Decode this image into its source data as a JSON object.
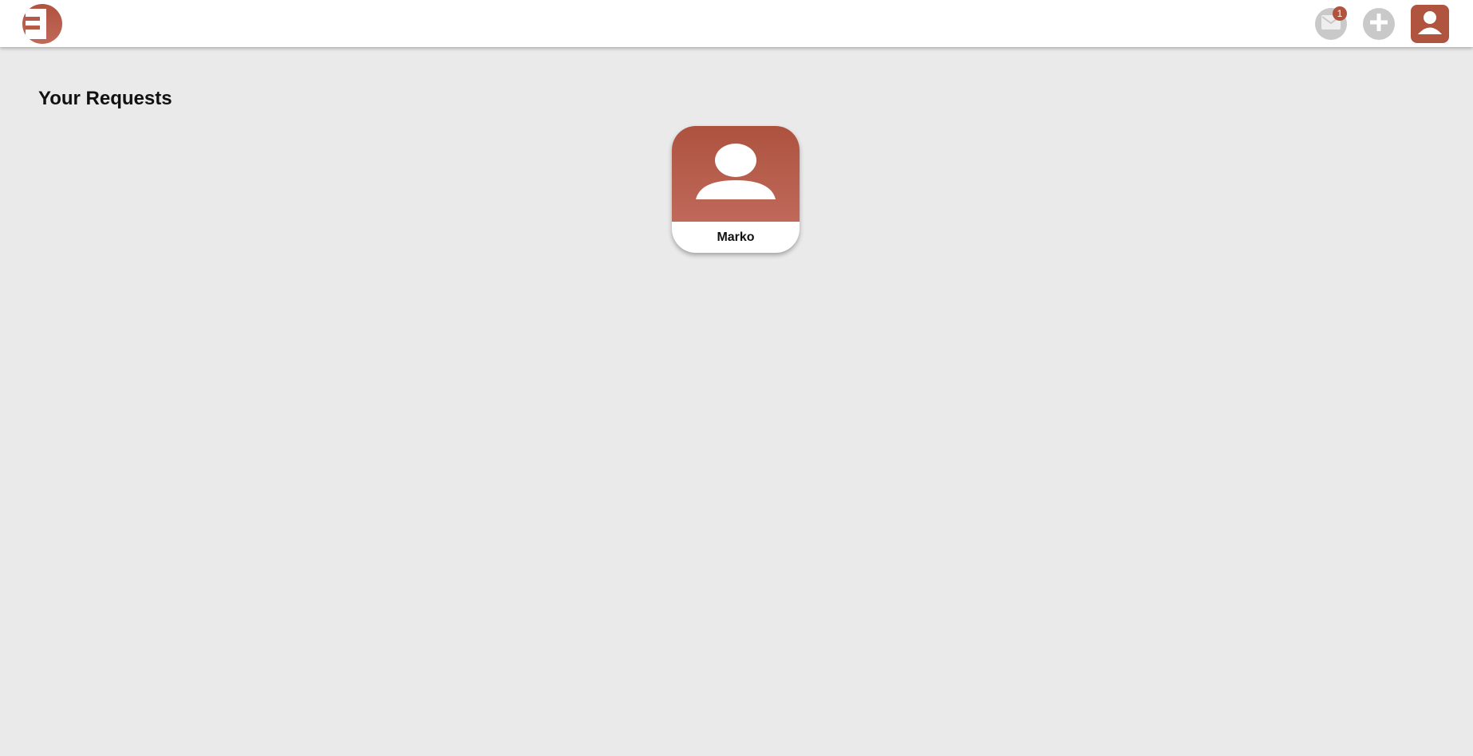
{
  "header": {
    "logo_icon": "brand-logo-icon",
    "mail": {
      "icon": "envelope-icon",
      "unread_count": "1"
    },
    "add": {
      "icon": "plus-icon"
    },
    "profile": {
      "icon": "user-icon"
    }
  },
  "main": {
    "title": "Your Requests",
    "requests": [
      {
        "name": "Marko",
        "icon": "user-avatar-icon"
      }
    ]
  },
  "colors": {
    "accent": "#b0533f",
    "background": "#eaeaea",
    "icon_button_bg": "#c9c9c9"
  }
}
